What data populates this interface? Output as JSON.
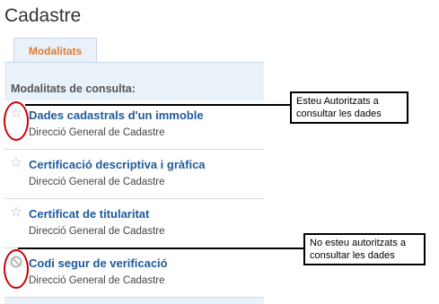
{
  "page": {
    "title": "Cadastre"
  },
  "tabs": [
    {
      "label": "Modalitats",
      "active": true
    }
  ],
  "section_label": "Modalitats de consulta:",
  "items": [
    {
      "title": "Dades cadastrals d'un immoble",
      "subtitle": "Direcció General de Cadastre",
      "icon": "star-icon"
    },
    {
      "title": "Certificació descriptiva i gràfica",
      "subtitle": "Direcció General de Cadastre",
      "icon": "star-icon"
    },
    {
      "title": "Certificat de titularitat",
      "subtitle": "Direcció General de Cadastre",
      "icon": "star-icon"
    },
    {
      "title": "Codi segur de verificació",
      "subtitle": "Direcció General de Cadastre",
      "icon": "prohibited-icon"
    }
  ],
  "annotations": [
    {
      "text": "Esteu Autoritzats a consultar les dades"
    },
    {
      "text": "No esteu autoritzats a consultar les dades"
    }
  ],
  "colors": {
    "tab_text": "#e07a2e",
    "link": "#1f5a9c",
    "panel": "#eaf2f9",
    "annotation_circle": "#cc0000"
  }
}
